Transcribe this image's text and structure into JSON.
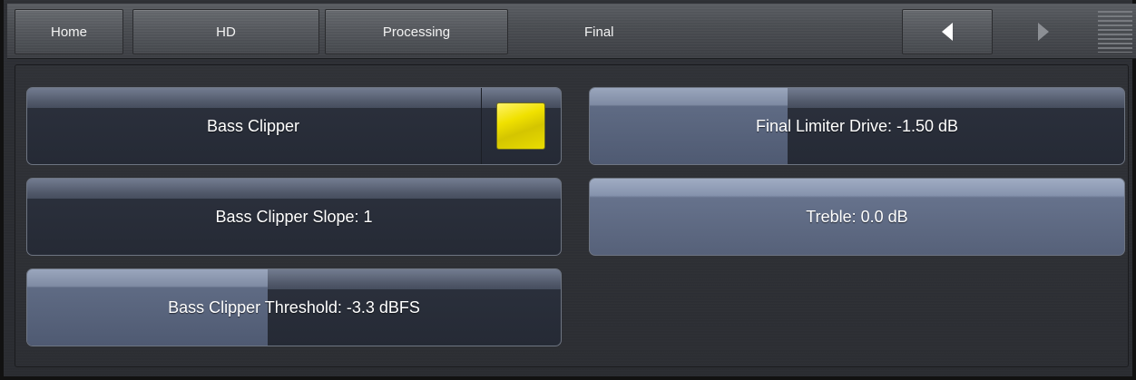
{
  "nav": {
    "home": "Home",
    "hd": "HD",
    "processing": "Processing",
    "current": "Final",
    "prev_icon": "triangle-left-icon",
    "next_icon": "triangle-right-icon",
    "menu_icon": "menu-lines-icon"
  },
  "controls": {
    "bass_clipper": {
      "label": "Bass Clipper",
      "enabled": true,
      "indicator_color": "#f0e100"
    },
    "bass_clipper_slope": {
      "label": "Bass Clipper Slope: 1"
    },
    "bass_clipper_threshold": {
      "label": "Bass Clipper Threshold: -3.3 dBFS",
      "level_percent": 45
    },
    "final_limiter_drive": {
      "label": "Final Limiter Drive: -1.50 dB",
      "level_percent": 37
    },
    "treble": {
      "label": "Treble: 0.0 dB",
      "level_percent": 100
    }
  },
  "colors": {
    "accent_fill": "#7f8ba3",
    "indicator_on": "#f0e100"
  }
}
